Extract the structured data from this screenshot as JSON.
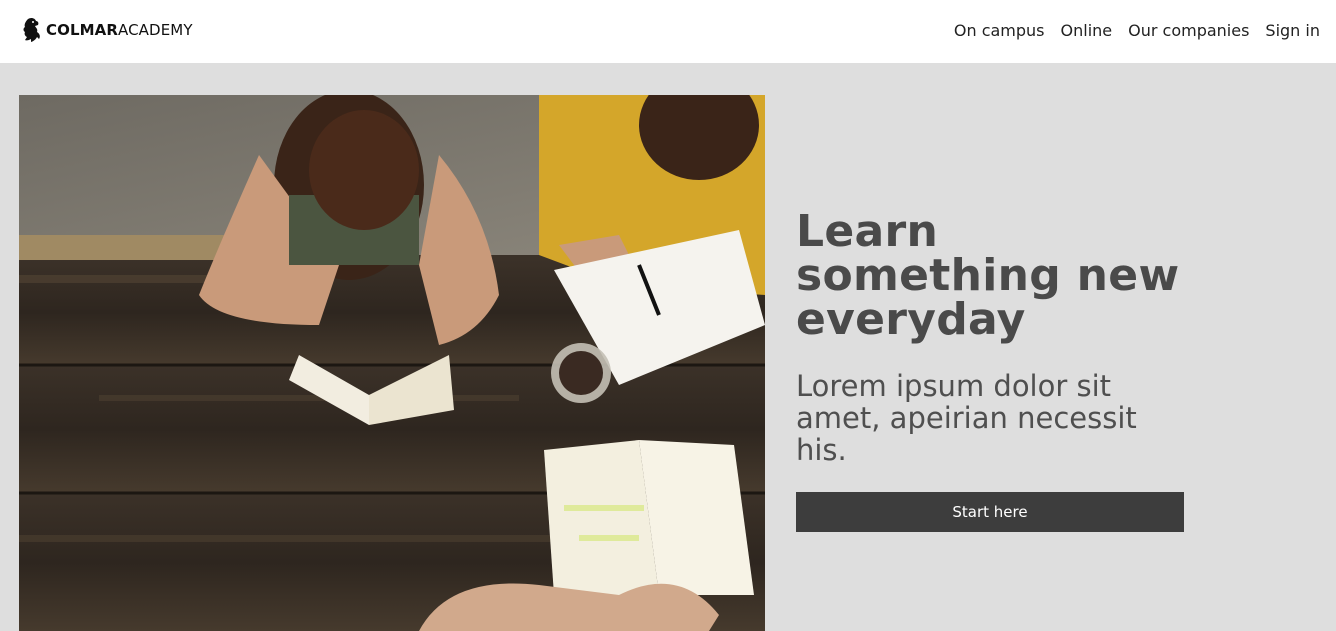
{
  "brand": {
    "name_bold": "COLMAR",
    "name_thin": "ACADEMY",
    "logo_icon": "lion-rampant-icon"
  },
  "nav": {
    "items": [
      {
        "label": "On campus"
      },
      {
        "label": "Online"
      },
      {
        "label": "Our companies"
      },
      {
        "label": "Sign in"
      }
    ]
  },
  "hero": {
    "image": "students-studying-at-wooden-table-photo",
    "headline": "Learn something new everyday",
    "subtitle": "Lorem ipsum dolor sit amet, apeirian necessit his.",
    "cta_label": "Start here"
  },
  "colors": {
    "page_background": "#dedede",
    "header_background": "#ffffff",
    "headline": "#4a4a4a",
    "button_background": "#3d3d3d",
    "button_text": "#ffffff"
  }
}
